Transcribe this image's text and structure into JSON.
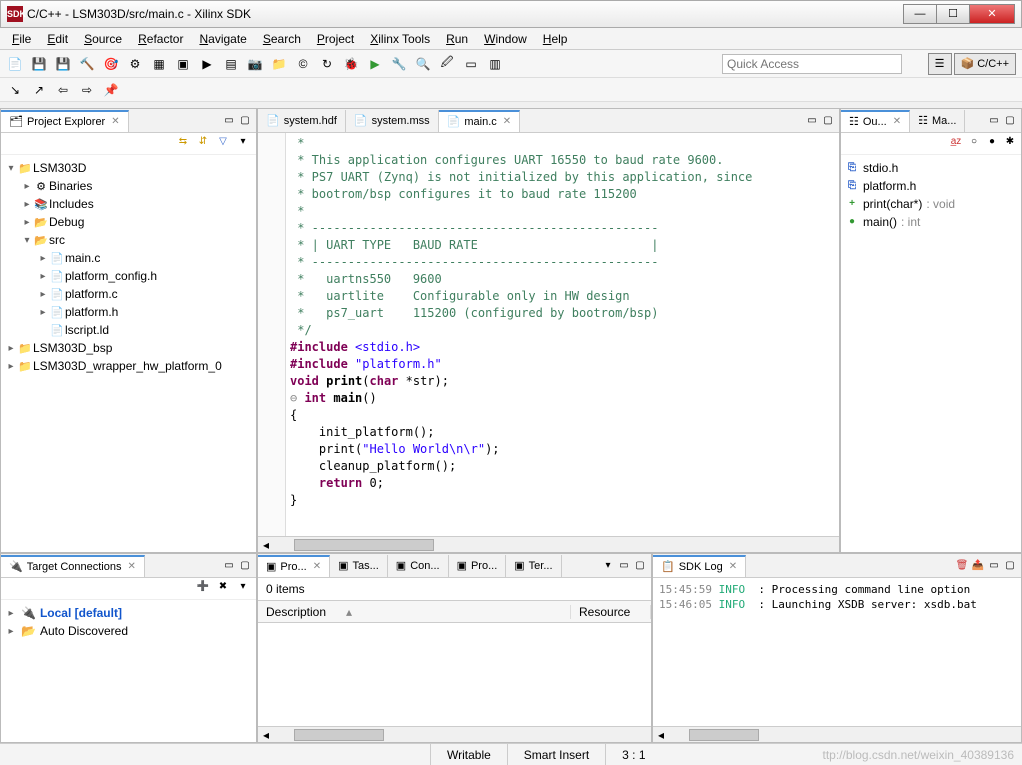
{
  "window": {
    "title": "C/C++ - LSM303D/src/main.c - Xilinx SDK",
    "app_icon": "SDK"
  },
  "menu": [
    "File",
    "Edit",
    "Source",
    "Refactor",
    "Navigate",
    "Search",
    "Project",
    "Xilinx Tools",
    "Run",
    "Window",
    "Help"
  ],
  "quick_access_placeholder": "Quick Access",
  "perspective": {
    "label": "C/C++"
  },
  "project_explorer": {
    "title": "Project Explorer",
    "tree": [
      {
        "depth": 0,
        "expander": "▾",
        "icon": "📁",
        "label": "LSM303D"
      },
      {
        "depth": 1,
        "expander": "▸",
        "icon": "⚙",
        "label": "Binaries"
      },
      {
        "depth": 1,
        "expander": "▸",
        "icon": "📚",
        "label": "Includes"
      },
      {
        "depth": 1,
        "expander": "▸",
        "icon": "📂",
        "label": "Debug"
      },
      {
        "depth": 1,
        "expander": "▾",
        "icon": "📂",
        "label": "src"
      },
      {
        "depth": 2,
        "expander": "▸",
        "icon": "📄",
        "label": "main.c"
      },
      {
        "depth": 2,
        "expander": "▸",
        "icon": "📄",
        "label": "platform_config.h"
      },
      {
        "depth": 2,
        "expander": "▸",
        "icon": "📄",
        "label": "platform.c"
      },
      {
        "depth": 2,
        "expander": "▸",
        "icon": "📄",
        "label": "platform.h"
      },
      {
        "depth": 2,
        "expander": " ",
        "icon": "📄",
        "label": "lscript.ld"
      },
      {
        "depth": 0,
        "expander": "▸",
        "icon": "📁",
        "label": "LSM303D_bsp"
      },
      {
        "depth": 0,
        "expander": "▸",
        "icon": "📁",
        "label": "LSM303D_wrapper_hw_platform_0"
      }
    ]
  },
  "editors": {
    "tabs": [
      {
        "label": "system.hdf",
        "icon": "📄",
        "active": false
      },
      {
        "label": "system.mss",
        "icon": "📄",
        "active": false
      },
      {
        "label": "main.c",
        "icon": "📄",
        "active": true
      }
    ],
    "code_lines": [
      {
        "cls": "cmt",
        "text": " *"
      },
      {
        "cls": "cmt",
        "text": " * This application configures UART 16550 to baud rate 9600."
      },
      {
        "cls": "cmt",
        "text": " * PS7 UART (Zynq) is not initialized by this application, since"
      },
      {
        "cls": "cmt",
        "text": " * bootrom/bsp configures it to baud rate 115200"
      },
      {
        "cls": "cmt",
        "text": " *"
      },
      {
        "cls": "cmt",
        "text": " * ------------------------------------------------"
      },
      {
        "cls": "cmt",
        "text": " * | UART TYPE   BAUD RATE                        |"
      },
      {
        "cls": "cmt",
        "text": " * ------------------------------------------------"
      },
      {
        "cls": "cmt",
        "text": " *   uartns550   9600"
      },
      {
        "cls": "cmt",
        "text": " *   uartlite    Configurable only in HW design"
      },
      {
        "cls": "cmt",
        "text": " *   ps7_uart    115200 (configured by bootrom/bsp)"
      },
      {
        "cls": "cmt",
        "text": " */"
      },
      {
        "cls": "",
        "text": ""
      },
      {
        "cls": "pp",
        "text": "#include <stdio.h>"
      },
      {
        "cls": "pp",
        "text": "#include \"platform.h\""
      },
      {
        "cls": "",
        "text": ""
      },
      {
        "cls": "fn",
        "text": "void print(char *str);"
      },
      {
        "cls": "",
        "text": ""
      },
      {
        "cls": "fn2",
        "text": "int main()"
      },
      {
        "cls": "",
        "text": "{"
      },
      {
        "cls": "",
        "text": "    init_platform();"
      },
      {
        "cls": "",
        "text": ""
      },
      {
        "cls": "call",
        "text": "    print(\"Hello World\\n\\r\");"
      },
      {
        "cls": "",
        "text": ""
      },
      {
        "cls": "",
        "text": "    cleanup_platform();"
      },
      {
        "cls": "ret",
        "text": "    return 0;"
      },
      {
        "cls": "",
        "text": "}"
      }
    ]
  },
  "outline": {
    "tabs": [
      {
        "label": "Ou...",
        "active": true
      },
      {
        "label": "Ma...",
        "active": false
      }
    ],
    "items": [
      {
        "glyph": "⎘",
        "color": "#36c",
        "label": "stdio.h",
        "ret": ""
      },
      {
        "glyph": "⎘",
        "color": "#36c",
        "label": "platform.h",
        "ret": ""
      },
      {
        "glyph": "+",
        "color": "#393",
        "label": "print(char*)",
        "ret": " : void"
      },
      {
        "glyph": "●",
        "color": "#393",
        "label": "main()",
        "ret": " : int"
      }
    ]
  },
  "target_connections": {
    "title": "Target Connections",
    "items": [
      {
        "expander": "▸",
        "icon": "🔌",
        "label": "Local [default]",
        "bold": true
      },
      {
        "expander": "▸",
        "icon": "📂",
        "label": "Auto Discovered",
        "bold": false
      }
    ]
  },
  "problems": {
    "tabs": [
      {
        "label": "Pro...",
        "active": true
      },
      {
        "label": "Tas...",
        "active": false
      },
      {
        "label": "Con...",
        "active": false
      },
      {
        "label": "Pro...",
        "active": false
      },
      {
        "label": "Ter...",
        "active": false
      }
    ],
    "count": "0 items",
    "columns": [
      "Description",
      "Resource"
    ]
  },
  "sdk_log": {
    "title": "SDK Log",
    "lines": [
      {
        "time": "15:45:59",
        "level": "INFO",
        "msg": ": Processing command line option"
      },
      {
        "time": "15:46:05",
        "level": "INFO",
        "msg": ": Launching XSDB server: xsdb.bat"
      }
    ]
  },
  "status": {
    "writable": "Writable",
    "insert": "Smart Insert",
    "pos": "3 : 1"
  },
  "watermark": "ttp://blog.csdn.net/weixin_40389136"
}
